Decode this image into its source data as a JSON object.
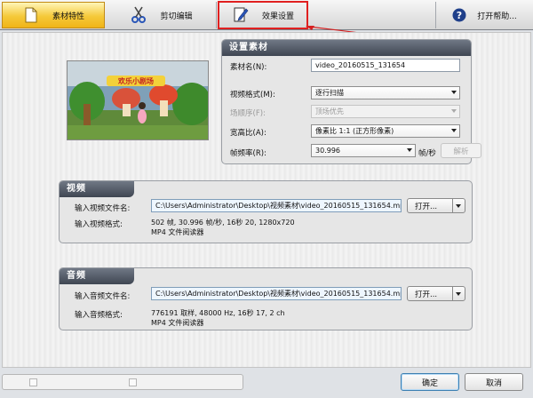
{
  "toolbar": {
    "tab_material": "素材特性",
    "tab_cut": "剪切编辑",
    "tab_effects": "效果设置",
    "help": "打开帮助..."
  },
  "settings": {
    "title": "设置素材",
    "name_label": "素材名(N):",
    "name_value": "video_20160515_131654",
    "scan_label": "视频格式(M):",
    "scan_value": "逐行扫描",
    "field_order_label": "场顺序(F):",
    "field_order_value": "顶场优先",
    "aspect_label": "宽高比(A):",
    "aspect_value": "像素比 1:1 (正方形像素)",
    "fps_label": "帧频率(R):",
    "fps_value": "30.996",
    "fps_unit": "帧/秒",
    "parse_button": "解析"
  },
  "video": {
    "title": "视频",
    "file_label": "输入视频文件名:",
    "file_value": "C:\\Users\\Administrator\\Desktop\\视频素材\\video_20160515_131654.mp4",
    "open_button": "打开...",
    "format_label": "输入视频格式:",
    "format_line1": "502 帧, 30.996 帧/秒, 16秒 20, 1280x720",
    "format_line2": "MP4 文件阅读器"
  },
  "audio": {
    "title": "音频",
    "file_label": "输入音频文件名:",
    "file_value": "C:\\Users\\Administrator\\Desktop\\视频素材\\video_20160515_131654.mp4",
    "open_button": "打开...",
    "format_label": "输入音频格式:",
    "format_line1": "776191 取样, 48000 Hz, 16秒 17, 2 ch",
    "format_line2": "MP4 文件阅读器"
  },
  "thumbnail": {
    "sign_text": "欢乐小剧场"
  },
  "bottom": {
    "check1": "",
    "check2": "",
    "ok": "确定",
    "cancel": "取消"
  },
  "colors": {
    "accent_active_tab": "#f5c93a",
    "highlight_box": "#e02020",
    "panel_header": "#4a515c"
  }
}
